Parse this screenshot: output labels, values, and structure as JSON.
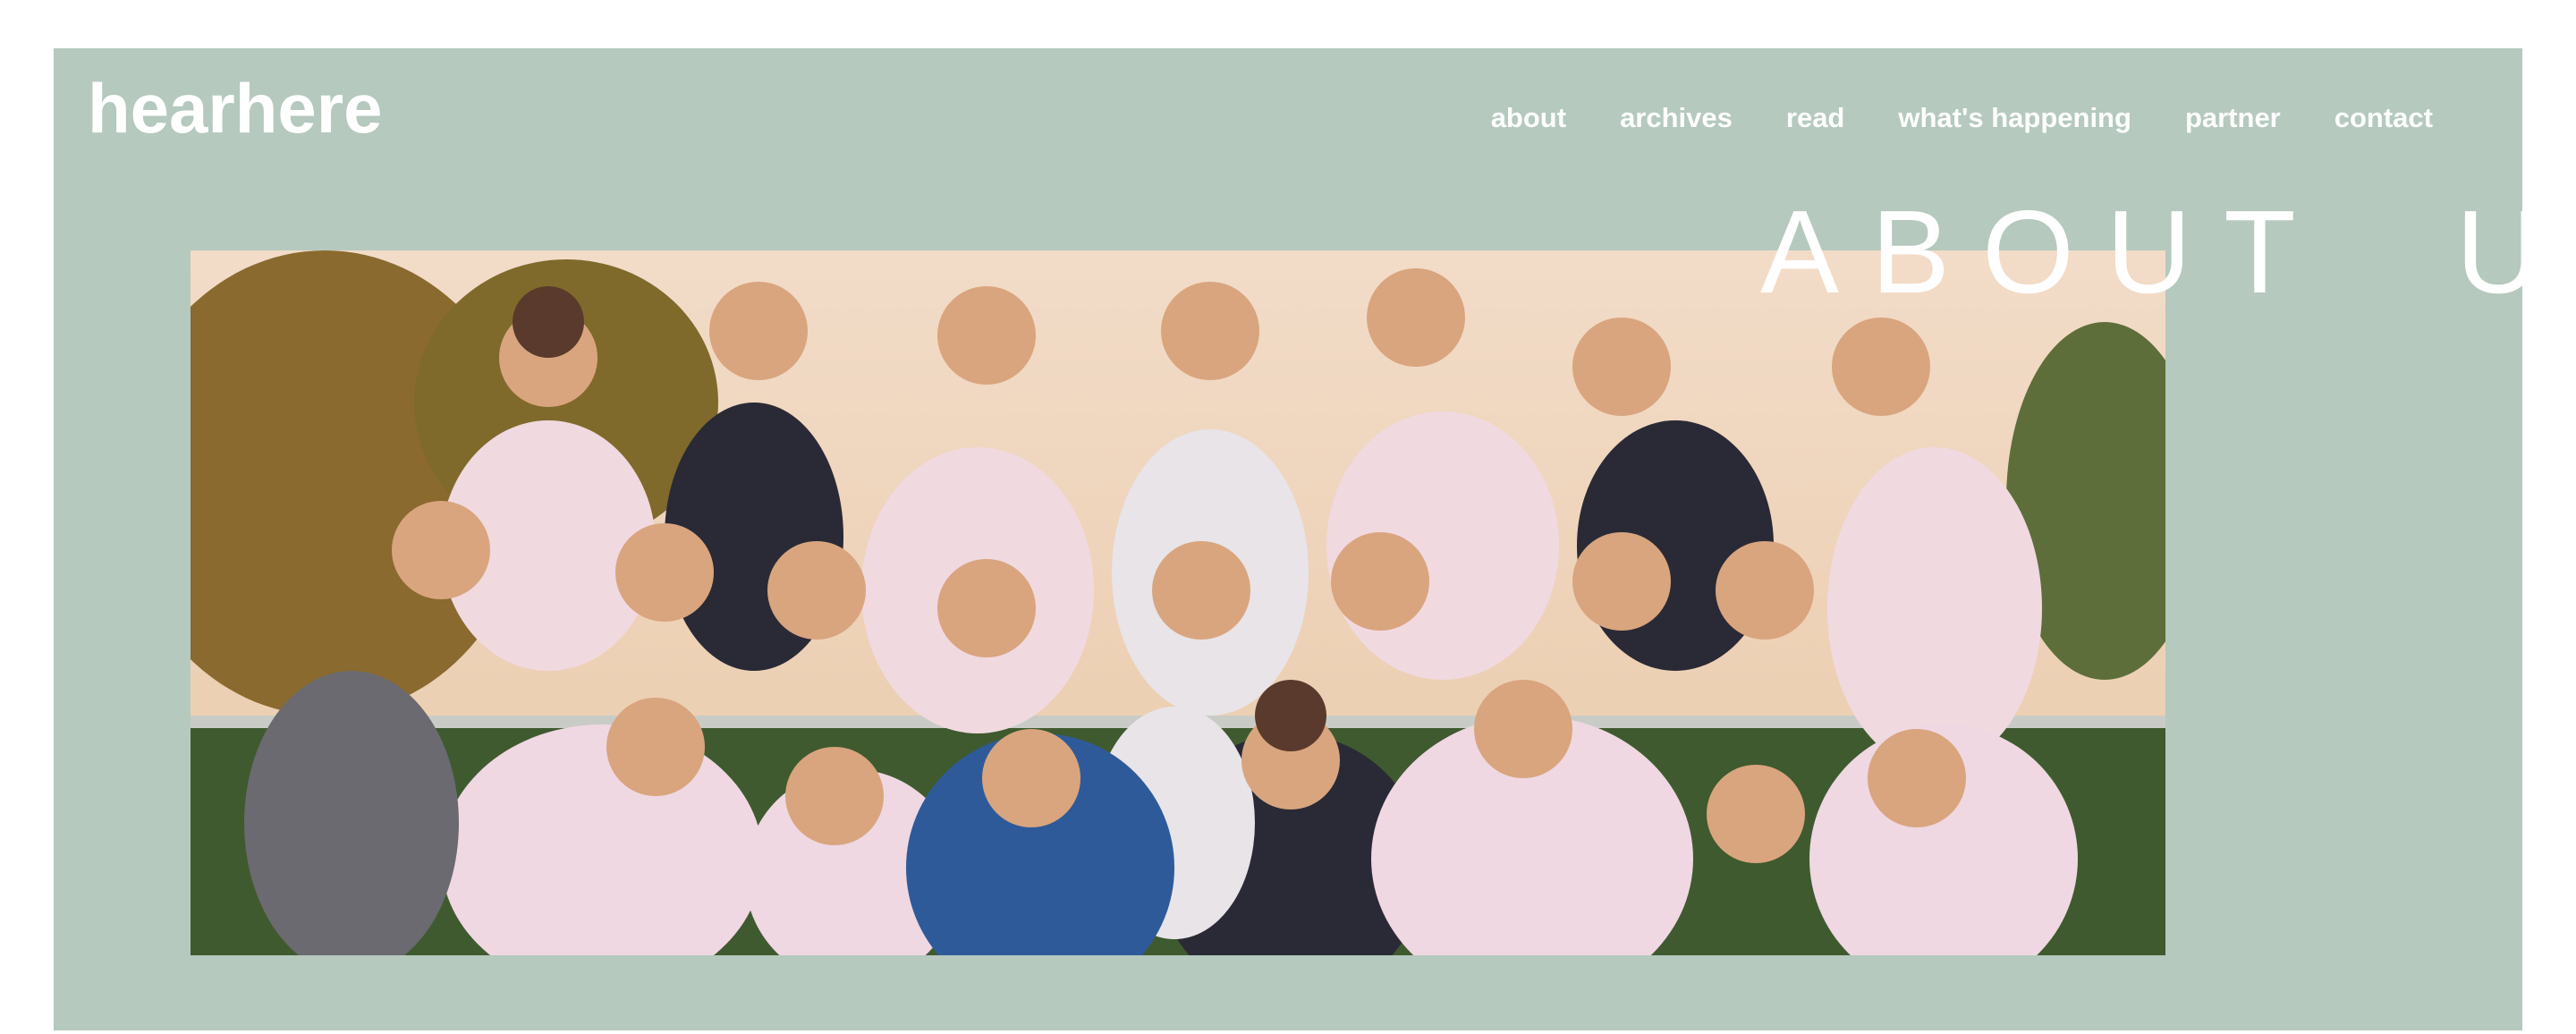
{
  "brand": {
    "logo_text": "hearhere"
  },
  "nav": {
    "items": [
      {
        "label": "about"
      },
      {
        "label": "archives"
      },
      {
        "label": "read"
      },
      {
        "label": "what's happening"
      },
      {
        "label": "partner"
      },
      {
        "label": "contact"
      }
    ]
  },
  "hero": {
    "title": "ABOUT  US",
    "photo_icon": "group-photo-image"
  },
  "colors": {
    "panel_background": "#b5c9be",
    "text": "#ffffff",
    "page_background": "#ffffff"
  }
}
